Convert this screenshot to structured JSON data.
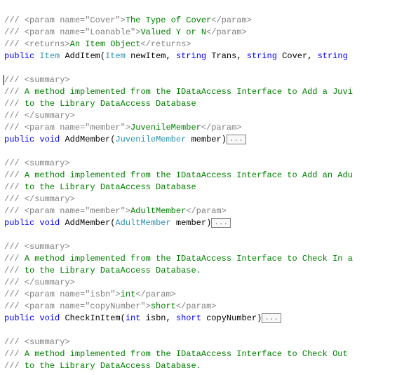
{
  "block0": {
    "l1_a": "/// <param name=\"Cover\">",
    "l1_b": "The Type of Cover",
    "l1_c": "</param>",
    "l2_a": "/// <param name=\"Loanable\">",
    "l2_b": "Valued Y or N",
    "l2_c": "</param>",
    "l3_a": "/// <returns>",
    "l3_b": "An Item Object",
    "l3_c": "</returns>",
    "sig_kw1": "public",
    "sig_ty1": "Item",
    "sig_m": "AddItem",
    "sig_ty2": "Item",
    "sig_p1": "newItem",
    "sig_kw2": "string",
    "sig_p2": "Trans",
    "sig_kw3": "string",
    "sig_p3": "Cover",
    "sig_kw4": "string"
  },
  "block1": {
    "l1": "/// <summary>",
    "l2_a": "/// ",
    "l2_b": "A method implemented from the IDataAccess Interface to Add a Juvi",
    "l3_a": "/// ",
    "l3_b": "to the Library DataAccess Database",
    "l4": "/// </summary>",
    "l5_a": "/// <param name=\"member\">",
    "l5_b": "JuvenileMember",
    "l5_c": "</param>",
    "sig_kw1": "public",
    "sig_kw2": "void",
    "sig_m": "AddMember",
    "sig_ty": "JuvenileMember",
    "sig_p": "member",
    "collapse": "..."
  },
  "block2": {
    "l1": "/// <summary>",
    "l2_a": "/// ",
    "l2_b": "A method implemented from the IDataAccess Interface to Add an Adu",
    "l3_a": "/// ",
    "l3_b": "to the Library DataAccess Database",
    "l4": "/// </summary>",
    "l5_a": "/// <param name=\"member\">",
    "l5_b": "AdultMember",
    "l5_c": "</param>",
    "sig_kw1": "public",
    "sig_kw2": "void",
    "sig_m": "AddMember",
    "sig_ty": "AdultMember",
    "sig_p": "member",
    "collapse": "..."
  },
  "block3": {
    "l1": "/// <summary>",
    "l2_a": "/// ",
    "l2_b": "A method implemented from the IDataAccess Interface to Check In a",
    "l3_a": "/// ",
    "l3_b": "to the Library DataAccess Database.",
    "l4": "/// </summary>",
    "l5_a": "/// <param name=\"isbn\">",
    "l5_b": "int",
    "l5_c": "</param>",
    "l6_a": "/// <param name=\"copyNumber\">",
    "l6_b": "short",
    "l6_c": "</param>",
    "sig_kw1": "public",
    "sig_kw2": "void",
    "sig_m": "CheckInItem",
    "sig_kw3": "int",
    "sig_p1": "isbn",
    "sig_kw4": "short",
    "sig_p2": "copyNumber",
    "collapse": "..."
  },
  "block4": {
    "l1": "/// <summary>",
    "l2_a": "/// ",
    "l2_b": "A method implemented from the IDataAccess Interface to Check Out ",
    "l3_a": "/// ",
    "l3_b": "to the Library DataAccess Database."
  }
}
